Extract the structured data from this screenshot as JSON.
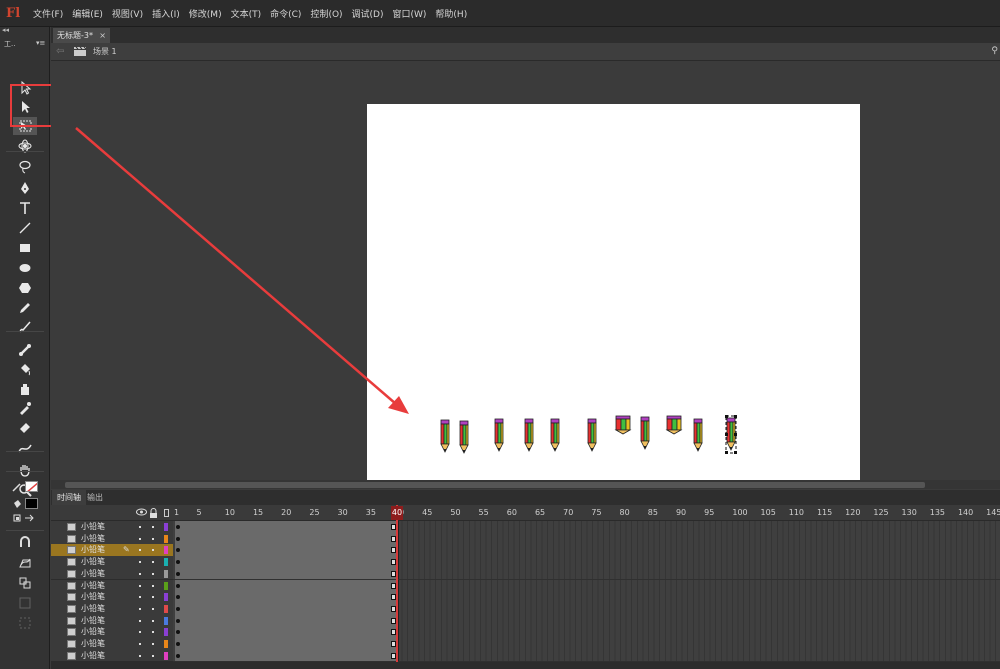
{
  "app": {
    "logo": "Fl"
  },
  "menu": [
    "文件(F)",
    "编辑(E)",
    "视图(V)",
    "插入(I)",
    "修改(M)",
    "文本(T)",
    "命令(C)",
    "控制(O)",
    "调试(D)",
    "窗口(W)",
    "帮助(H)"
  ],
  "tools_panel": {
    "collapse": "◂◂",
    "title": "工..",
    "menu": "▾≡"
  },
  "tools": [
    {
      "name": "selection-tool-icon"
    },
    {
      "name": "subselection-tool-icon"
    },
    {
      "name": "free-transform-tool-icon",
      "active": true
    },
    {
      "name": "3d-rotation-tool-icon"
    },
    {
      "name": "lasso-tool-icon"
    },
    {
      "name": "pen-tool-icon"
    },
    {
      "name": "text-tool-icon"
    },
    {
      "name": "line-tool-icon"
    },
    {
      "name": "rectangle-tool-icon"
    },
    {
      "name": "oval-tool-icon"
    },
    {
      "name": "polystar-tool-icon"
    },
    {
      "name": "pencil-tool-icon"
    },
    {
      "name": "brush-tool-icon"
    },
    {
      "name": "bone-tool-icon"
    },
    {
      "name": "paint-bucket-tool-icon"
    },
    {
      "name": "ink-bottle-tool-icon"
    },
    {
      "name": "eyedropper-tool-icon"
    },
    {
      "name": "eraser-tool-icon"
    },
    {
      "name": "width-tool-icon"
    },
    {
      "name": "hand-tool-icon"
    },
    {
      "name": "zoom-tool-icon"
    }
  ],
  "colors": {
    "stroke": "#e04040",
    "fill": "#000000",
    "highlight": "#e83c3c",
    "selected_layer": "#9a7620",
    "playhead": "#d83a3a"
  },
  "document": {
    "tab_title": "无标题-3*",
    "close": "×",
    "scene_label": "场景 1"
  },
  "timeline": {
    "tabs": [
      "时间轴",
      "输出"
    ],
    "current_frame": "40",
    "ticks": [
      "1",
      "5",
      "10",
      "15",
      "20",
      "25",
      "30",
      "35",
      "40",
      "45",
      "50",
      "55",
      "60",
      "65",
      "70",
      "75",
      "80",
      "85",
      "90",
      "95",
      "100",
      "105",
      "110",
      "115",
      "120",
      "125",
      "130",
      "135",
      "140",
      "145"
    ],
    "layers": [
      {
        "name": "小铅笔",
        "color": "#8a3fd4",
        "selected": false
      },
      {
        "name": "小铅笔",
        "color": "#e8861a",
        "selected": false
      },
      {
        "name": "小铅笔",
        "color": "#e040c0",
        "selected": true
      },
      {
        "name": "小铅笔",
        "color": "#1ab0b0",
        "selected": false
      },
      {
        "name": "小铅笔",
        "color": "#9a9a9a",
        "selected": false
      },
      {
        "name": "小铅笔",
        "color": "#5aa01a",
        "selected": false
      },
      {
        "name": "小铅笔",
        "color": "#8a3fd4",
        "selected": false
      },
      {
        "name": "小铅笔",
        "color": "#e04a4a",
        "selected": false
      },
      {
        "name": "小铅笔",
        "color": "#4a7ae0",
        "selected": false
      },
      {
        "name": "小铅笔",
        "color": "#8a3fd4",
        "selected": false
      },
      {
        "name": "小铅笔",
        "color": "#e8861a",
        "selected": false
      },
      {
        "name": "小铅笔",
        "color": "#e040c0",
        "selected": false
      }
    ]
  }
}
